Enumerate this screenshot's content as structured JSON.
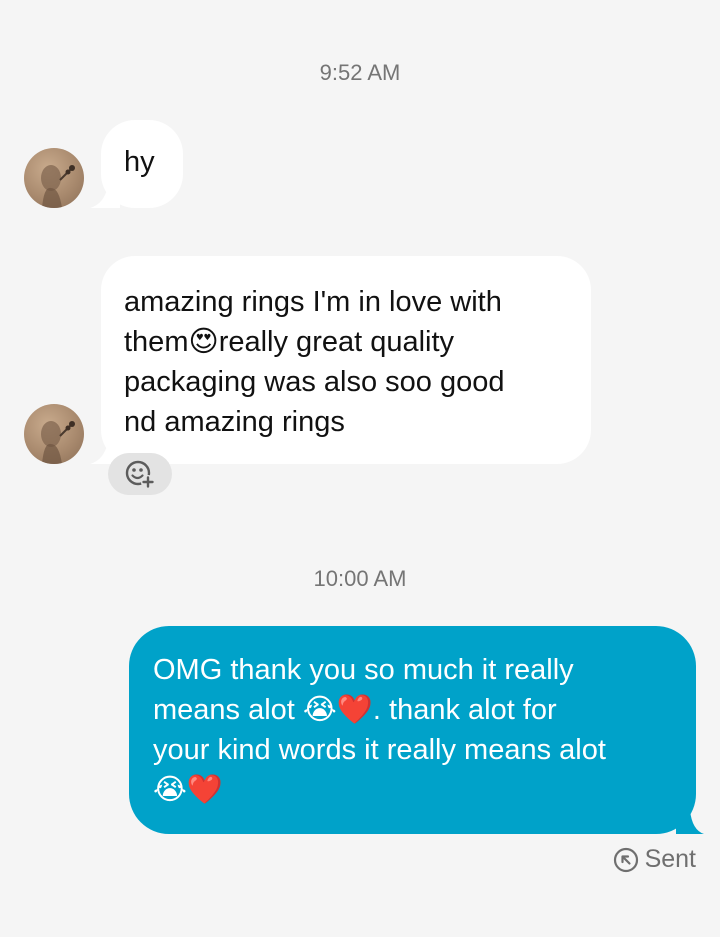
{
  "conversation": {
    "messages": [
      {
        "timestamp": "9:52 AM",
        "direction": "incoming",
        "text": "hy"
      },
      {
        "direction": "incoming",
        "lines": [
          "amazing rings I'm in love with",
          "them😍really great quality",
          "packaging was also soo good",
          "nd amazing rings"
        ]
      },
      {
        "timestamp": "10:00 AM",
        "direction": "outgoing",
        "lines": [
          "OMG thank you so much it really",
          "means alot 😭❤️. thank alot for",
          "your kind words it really means alot",
          "😭❤️"
        ]
      }
    ],
    "status": {
      "icon": "sent-arrow-icon",
      "label": "Sent"
    }
  },
  "avatar": {
    "icon": "profile-photo"
  },
  "reaction_button": {
    "icon": "add-reaction-icon"
  },
  "colors": {
    "background": "#f5f5f5",
    "incoming_bubble": "#ffffff",
    "outgoing_bubble": "#00a2c9",
    "timestamp_text": "#757575",
    "status_text": "#6f6f6f"
  }
}
